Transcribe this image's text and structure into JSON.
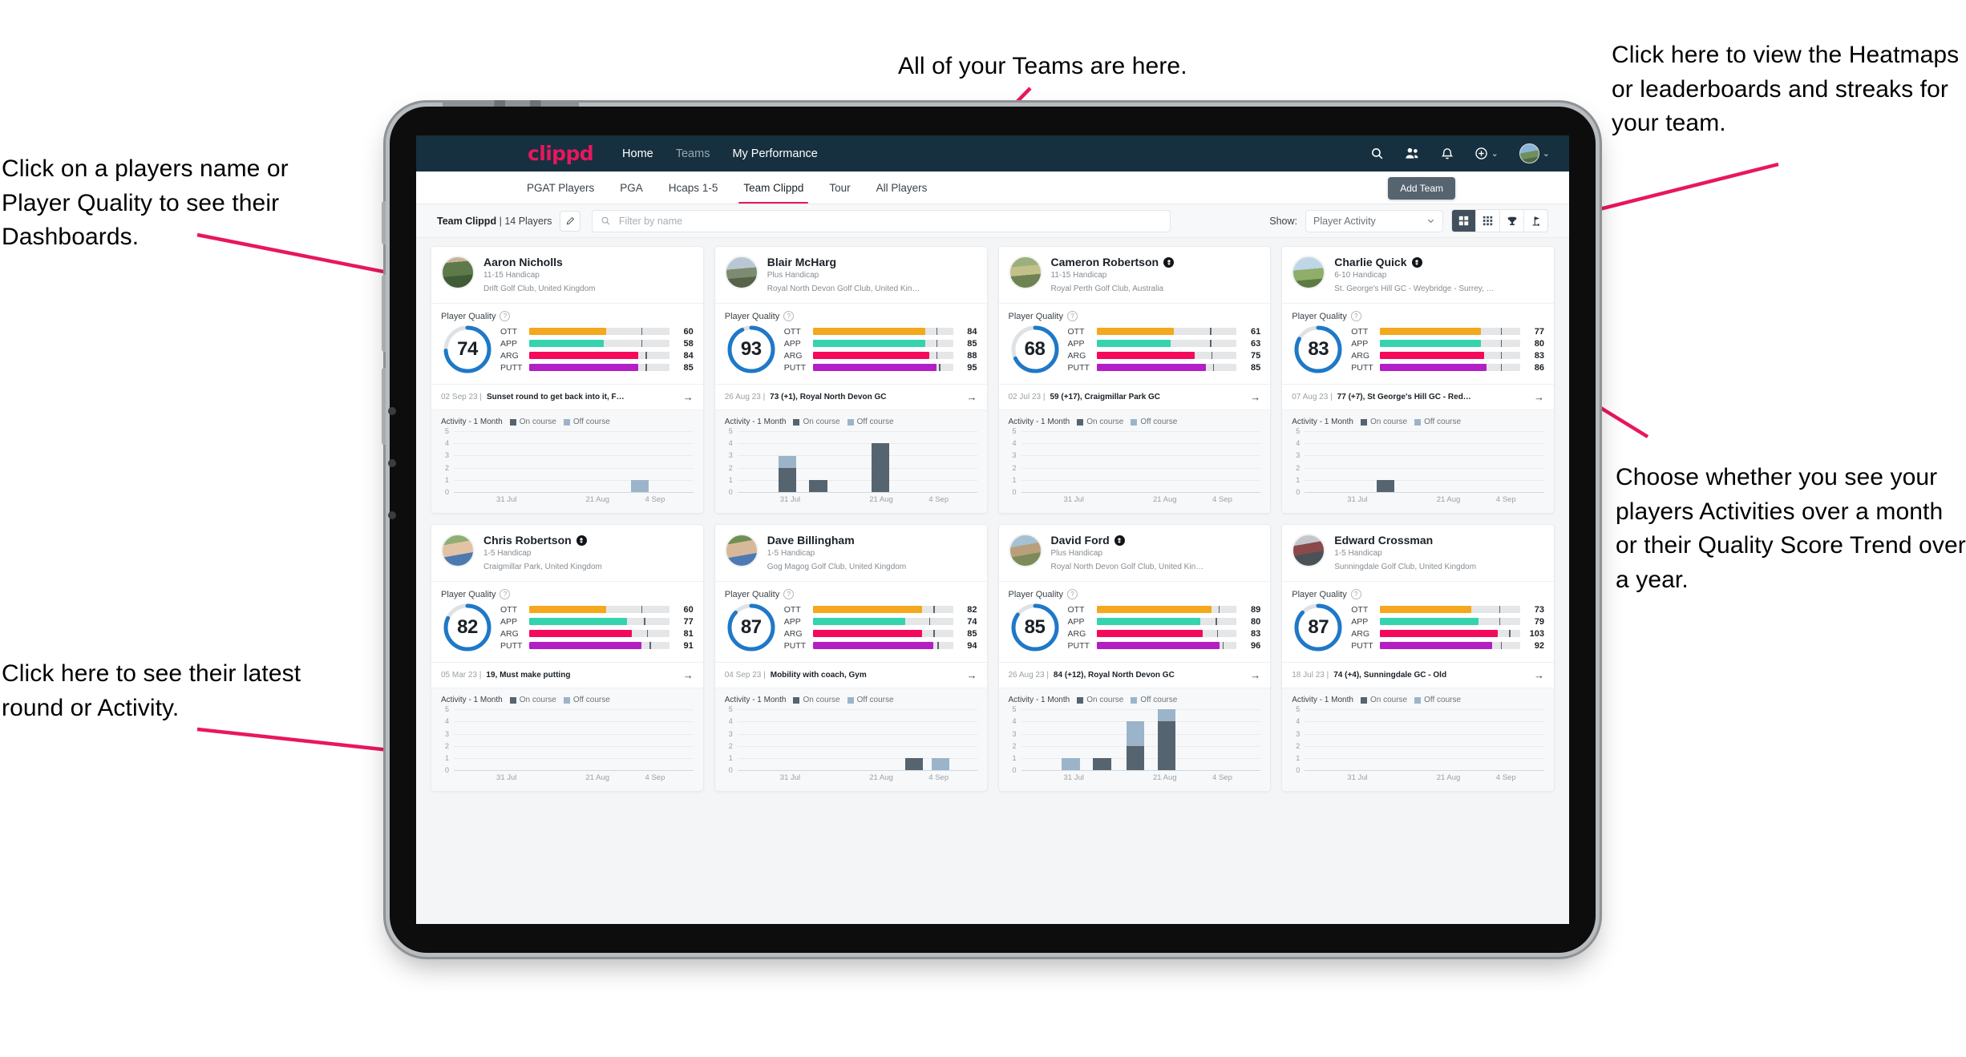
{
  "annotations": {
    "top_left": "Click on a players name or Player Quality to see their Dashboards.",
    "bottom_left": "Click here to see their latest round or Activity.",
    "top_center": "All of your Teams are here.",
    "top_right": "Click here to view the Heatmaps or leaderboards and streaks for your team.",
    "bottom_right": "Choose whether you see your players Activities over a month or their Quality Score Trend over a year.",
    "arrow_color": "#e8175d"
  },
  "appbar": {
    "logo": "clippd",
    "nav": [
      {
        "label": "Home",
        "active": true
      },
      {
        "label": "Teams",
        "active": false
      },
      {
        "label": "My Performance",
        "active": true
      }
    ],
    "icons": [
      "search-icon",
      "people-icon",
      "bell-icon",
      "add-circle-icon",
      "avatar"
    ],
    "background": "#16303f",
    "logo_color": "#e8175d"
  },
  "tabs": {
    "items": [
      "PGAT Players",
      "PGA",
      "Hcaps 1-5",
      "Team Clippd",
      "Tour",
      "All Players"
    ],
    "active": "Team Clippd",
    "active_underline_color": "#e8175d",
    "add_team_label": "Add Team"
  },
  "filterbar": {
    "team_name": "Team Clippd",
    "team_count": "14 Players",
    "separator": "|",
    "edit_icon": "pencil-icon",
    "search_placeholder": "Filter by name",
    "search_value": "",
    "show_label": "Show:",
    "show_value": "Player Activity",
    "show_options": [
      "Player Activity",
      "Quality Score Trend"
    ],
    "view_buttons": [
      "grid-large-icon",
      "grid-small-icon",
      "trophy-icon",
      "flag-icon"
    ],
    "view_selected_index": 0
  },
  "card_labels": {
    "player_quality": "Player Quality",
    "activity": "Activity - 1 Month",
    "legend_on": "On course",
    "legend_off": "Off course",
    "arrow": "→"
  },
  "metric_colors": {
    "OTT": "#f4a81d",
    "APP": "#35d3ae",
    "ARG": "#f5095b",
    "PUTT": "#b31fc4",
    "ring": "#1f78c8",
    "ring_track": "#dfe2e5",
    "on_course": "#566470",
    "off_course": "#9cb4ca"
  },
  "chart_data": {
    "type": "bar",
    "title": "Activity - 1 Month",
    "ylabel": "",
    "xlabel": "",
    "ylim": [
      0,
      5
    ],
    "yticks": [
      0,
      1,
      2,
      3,
      4,
      5
    ],
    "xticks": [
      "31 Jul",
      "21 Aug",
      "4 Sep"
    ],
    "grid": true,
    "legend": [
      "On course",
      "Off course"
    ],
    "stacked": true,
    "panels": [
      {
        "player": "Aaron Nicholls",
        "bars": [
          {
            "pos": 0.74,
            "on": 0,
            "off": 1
          }
        ]
      },
      {
        "player": "Blair McHarg",
        "bars": [
          {
            "pos": 0.17,
            "on": 2,
            "off": 1
          },
          {
            "pos": 0.3,
            "on": 1,
            "off": 0
          },
          {
            "pos": 0.56,
            "on": 4,
            "off": 0
          }
        ]
      },
      {
        "player": "Cameron Robertson",
        "bars": []
      },
      {
        "player": "Charlie Quick",
        "bars": [
          {
            "pos": 0.3,
            "on": 1,
            "off": 0
          }
        ]
      },
      {
        "player": "Chris Robertson",
        "bars": []
      },
      {
        "player": "Dave Billingham",
        "bars": [
          {
            "pos": 0.7,
            "on": 1,
            "off": 0
          },
          {
            "pos": 0.81,
            "on": 0,
            "off": 1
          }
        ]
      },
      {
        "player": "David Ford",
        "bars": [
          {
            "pos": 0.17,
            "on": 0,
            "off": 1
          },
          {
            "pos": 0.3,
            "on": 1,
            "off": 0
          },
          {
            "pos": 0.44,
            "on": 2,
            "off": 2
          },
          {
            "pos": 0.57,
            "on": 4,
            "off": 1
          }
        ]
      },
      {
        "player": "Edward Crossman",
        "bars": []
      }
    ]
  },
  "players": [
    {
      "name": "Aaron Nicholls",
      "verified": false,
      "handicap": "11-15 Handicap",
      "club": "Drift Golf Club, United Kingdom",
      "quality": 74,
      "metrics": [
        {
          "label": "OTT",
          "value": 60,
          "fill": 0.55,
          "tick": 0.8
        },
        {
          "label": "APP",
          "value": 58,
          "fill": 0.53,
          "tick": 0.8
        },
        {
          "label": "ARG",
          "value": 84,
          "fill": 0.78,
          "tick": 0.83
        },
        {
          "label": "PUTT",
          "value": 85,
          "fill": 0.78,
          "tick": 0.83
        }
      ],
      "last_date": "02 Sep 23",
      "last_text": "Sunset round to get back into it, F…",
      "avatar": "linear-gradient(175deg,#c9b39a 0 18%,#5e7a4a 18% 60%,#3f5c36 60% 100%)"
    },
    {
      "name": "Blair McHarg",
      "verified": false,
      "handicap": "Plus Handicap",
      "club": "Royal North Devon Golf Club, United Kin…",
      "quality": 93,
      "metrics": [
        {
          "label": "OTT",
          "value": 84,
          "fill": 0.8,
          "tick": 0.88
        },
        {
          "label": "APP",
          "value": 85,
          "fill": 0.8,
          "tick": 0.88
        },
        {
          "label": "ARG",
          "value": 88,
          "fill": 0.83,
          "tick": 0.88
        },
        {
          "label": "PUTT",
          "value": 95,
          "fill": 0.88,
          "tick": 0.9
        }
      ],
      "last_date": "26 Aug 23",
      "last_text": "73 (+1), Royal North Devon GC",
      "avatar": "linear-gradient(175deg,#b8c7d3 0 38%,#7d8b72 38% 66%,#566349 66% 100%)"
    },
    {
      "name": "Cameron Robertson",
      "verified": true,
      "handicap": "11-15 Handicap",
      "club": "Royal Perth Golf Club, Australia",
      "quality": 68,
      "metrics": [
        {
          "label": "OTT",
          "value": 61,
          "fill": 0.55,
          "tick": 0.81
        },
        {
          "label": "APP",
          "value": 63,
          "fill": 0.53,
          "tick": 0.81
        },
        {
          "label": "ARG",
          "value": 75,
          "fill": 0.7,
          "tick": 0.82
        },
        {
          "label": "PUTT",
          "value": 85,
          "fill": 0.78,
          "tick": 0.83
        }
      ],
      "last_date": "02 Jul 23",
      "last_text": "59 (+17), Craigmillar Park GC",
      "avatar": "linear-gradient(175deg,#9bb07c 0 30%,#c3c08a 30% 58%,#6f8352 58% 100%)"
    },
    {
      "name": "Charlie Quick",
      "verified": true,
      "handicap": "6-10 Handicap",
      "club": "St. George's Hill GC - Weybridge - Surrey, …",
      "quality": 83,
      "metrics": [
        {
          "label": "OTT",
          "value": 77,
          "fill": 0.72,
          "tick": 0.86
        },
        {
          "label": "APP",
          "value": 80,
          "fill": 0.72,
          "tick": 0.86
        },
        {
          "label": "ARG",
          "value": 83,
          "fill": 0.74,
          "tick": 0.86
        },
        {
          "label": "PUTT",
          "value": 86,
          "fill": 0.76,
          "tick": 0.86
        }
      ],
      "last_date": "07 Aug 23",
      "last_text": "77 (+7), St George's Hill GC - Red…",
      "avatar": "linear-gradient(175deg,#bfd6e6 0 40%,#8fae6a 40% 72%,#5d7a45 72% 100%)"
    },
    {
      "name": "Chris Robertson",
      "verified": true,
      "handicap": "1-5 Handicap",
      "club": "Craigmillar Park, United Kingdom",
      "quality": 82,
      "metrics": [
        {
          "label": "OTT",
          "value": 60,
          "fill": 0.55,
          "tick": 0.8
        },
        {
          "label": "APP",
          "value": 77,
          "fill": 0.7,
          "tick": 0.82
        },
        {
          "label": "ARG",
          "value": 81,
          "fill": 0.73,
          "tick": 0.84
        },
        {
          "label": "PUTT",
          "value": 91,
          "fill": 0.8,
          "tick": 0.86
        }
      ],
      "last_date": "05 Mar 23",
      "last_text": "19, Must make putting",
      "avatar": "linear-gradient(170deg,#8fae72 0 28%,#e3c3a6 28% 62%,#4c7ab0 62% 100%)"
    },
    {
      "name": "Dave Billingham",
      "verified": false,
      "handicap": "1-5 Handicap",
      "club": "Gog Magog Golf Club, United Kingdom",
      "quality": 87,
      "metrics": [
        {
          "label": "OTT",
          "value": 82,
          "fill": 0.78,
          "tick": 0.86
        },
        {
          "label": "APP",
          "value": 74,
          "fill": 0.66,
          "tick": 0.83
        },
        {
          "label": "ARG",
          "value": 85,
          "fill": 0.78,
          "tick": 0.86
        },
        {
          "label": "PUTT",
          "value": 94,
          "fill": 0.86,
          "tick": 0.89
        }
      ],
      "last_date": "04 Sep 23",
      "last_text": "Mobility with coach, Gym",
      "avatar": "linear-gradient(170deg,#6f8f52 0 26%,#d8b89a 26% 64%,#4d7ab2 64% 100%)"
    },
    {
      "name": "David Ford",
      "verified": true,
      "handicap": "Plus Handicap",
      "club": "Royal North Devon Golf Club, United Kin…",
      "quality": 85,
      "metrics": [
        {
          "label": "OTT",
          "value": 89,
          "fill": 0.82,
          "tick": 0.87
        },
        {
          "label": "APP",
          "value": 80,
          "fill": 0.74,
          "tick": 0.85
        },
        {
          "label": "ARG",
          "value": 83,
          "fill": 0.76,
          "tick": 0.86
        },
        {
          "label": "PUTT",
          "value": 96,
          "fill": 0.88,
          "tick": 0.9
        }
      ],
      "last_date": "26 Aug 23",
      "last_text": "84 (+12), Royal North Devon GC",
      "avatar": "linear-gradient(170deg,#a8c0d4 0 34%,#b9a07c 34% 62%,#7d8a5a 62% 100%)"
    },
    {
      "name": "Edward Crossman",
      "verified": false,
      "handicap": "1-5 Handicap",
      "club": "Sunningdale Golf Club, United Kingdom",
      "quality": 87,
      "metrics": [
        {
          "label": "OTT",
          "value": 73,
          "fill": 0.65,
          "tick": 0.85
        },
        {
          "label": "APP",
          "value": 79,
          "fill": 0.7,
          "tick": 0.85
        },
        {
          "label": "ARG",
          "value": 103,
          "fill": 0.84,
          "tick": 0.92
        },
        {
          "label": "PUTT",
          "value": 92,
          "fill": 0.8,
          "tick": 0.86
        }
      ],
      "last_date": "18 Jul 23",
      "last_text": "74 (+4), Sunningdale GC - Old",
      "avatar": "linear-gradient(170deg,#c4c8cc 0 30%,#8a4a4a 30% 58%,#4a5258 58% 100%)"
    }
  ]
}
